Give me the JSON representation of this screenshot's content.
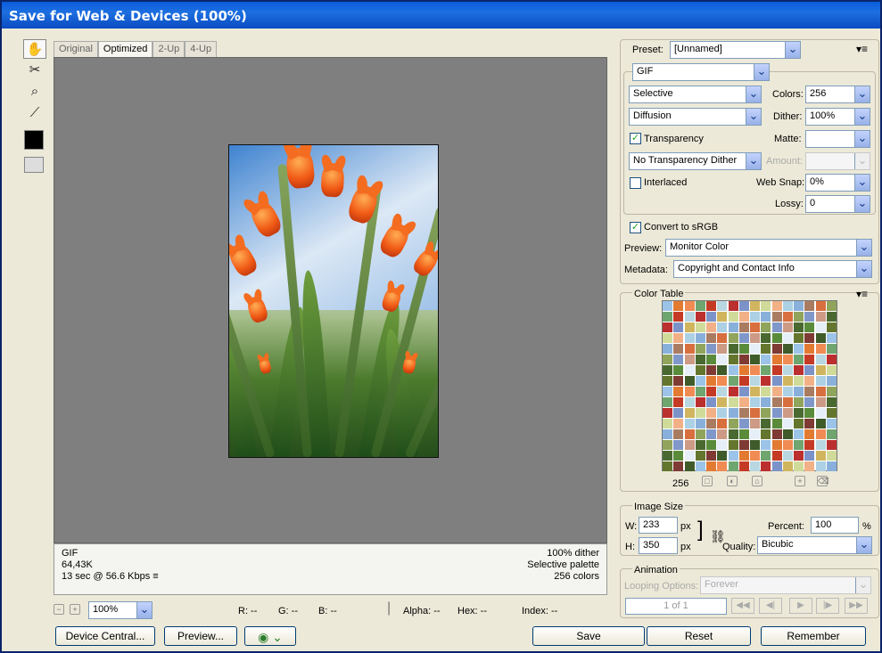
{
  "window": {
    "title": "Save for Web & Devices (100%)"
  },
  "tabs": [
    "Original",
    "Optimized",
    "2-Up",
    "4-Up"
  ],
  "info": {
    "format": "GIF",
    "size": "64,43K",
    "time": "13 sec @ 56.6 Kbps",
    "dither": "100% dither",
    "palette": "Selective palette",
    "colors": "256 colors"
  },
  "stats": {
    "zoom": "100%",
    "r": "R: --",
    "g": "G: --",
    "b": "B: --",
    "alpha": "Alpha: --",
    "hex": "Hex: --",
    "index": "Index: --"
  },
  "buttons": {
    "device_central": "Device Central...",
    "preview": "Preview...",
    "save": "Save",
    "reset": "Reset",
    "remember": "Remember"
  },
  "settings": {
    "preset_label": "Preset:",
    "preset": "[Unnamed]",
    "format": "GIF",
    "reduction": "Selective",
    "colors_label": "Colors:",
    "colors": "256",
    "dither_algorithm": "Diffusion",
    "dither_label": "Dither:",
    "dither": "100%",
    "transparency": "Transparency",
    "matte_label": "Matte:",
    "transparency_dither": "No Transparency Dither",
    "amount_label": "Amount:",
    "interlaced": "Interlaced",
    "web_snap_label": "Web Snap:",
    "web_snap": "0%",
    "lossy_label": "Lossy:",
    "lossy": "0",
    "convert": "Convert to sRGB",
    "preview_label": "Preview:",
    "preview": "Monitor Color",
    "metadata_label": "Metadata:",
    "metadata": "Copyright and Contact Info"
  },
  "color_table": {
    "title": "Color Table",
    "count": "256"
  },
  "image_size": {
    "title": "Image Size",
    "w_label": "W:",
    "width": "233",
    "h_label": "H:",
    "height": "350",
    "px": "px",
    "percent_label": "Percent:",
    "percent": "100",
    "percent_unit": "%",
    "quality_label": "Quality:",
    "quality": "Bicubic"
  },
  "animation": {
    "title": "Animation",
    "looping_label": "Looping Options:",
    "looping": "Forever",
    "frame": "1 of 1"
  },
  "colors": {
    "title_blue": "#0a58d6",
    "panel_bg": "#ece9d8",
    "viewport_gray": "#7f7f7f"
  },
  "icons": [
    "hand-icon",
    "slice-select-icon",
    "zoom-icon",
    "eyedropper-icon",
    "menu-icon",
    "browser-icon"
  ]
}
